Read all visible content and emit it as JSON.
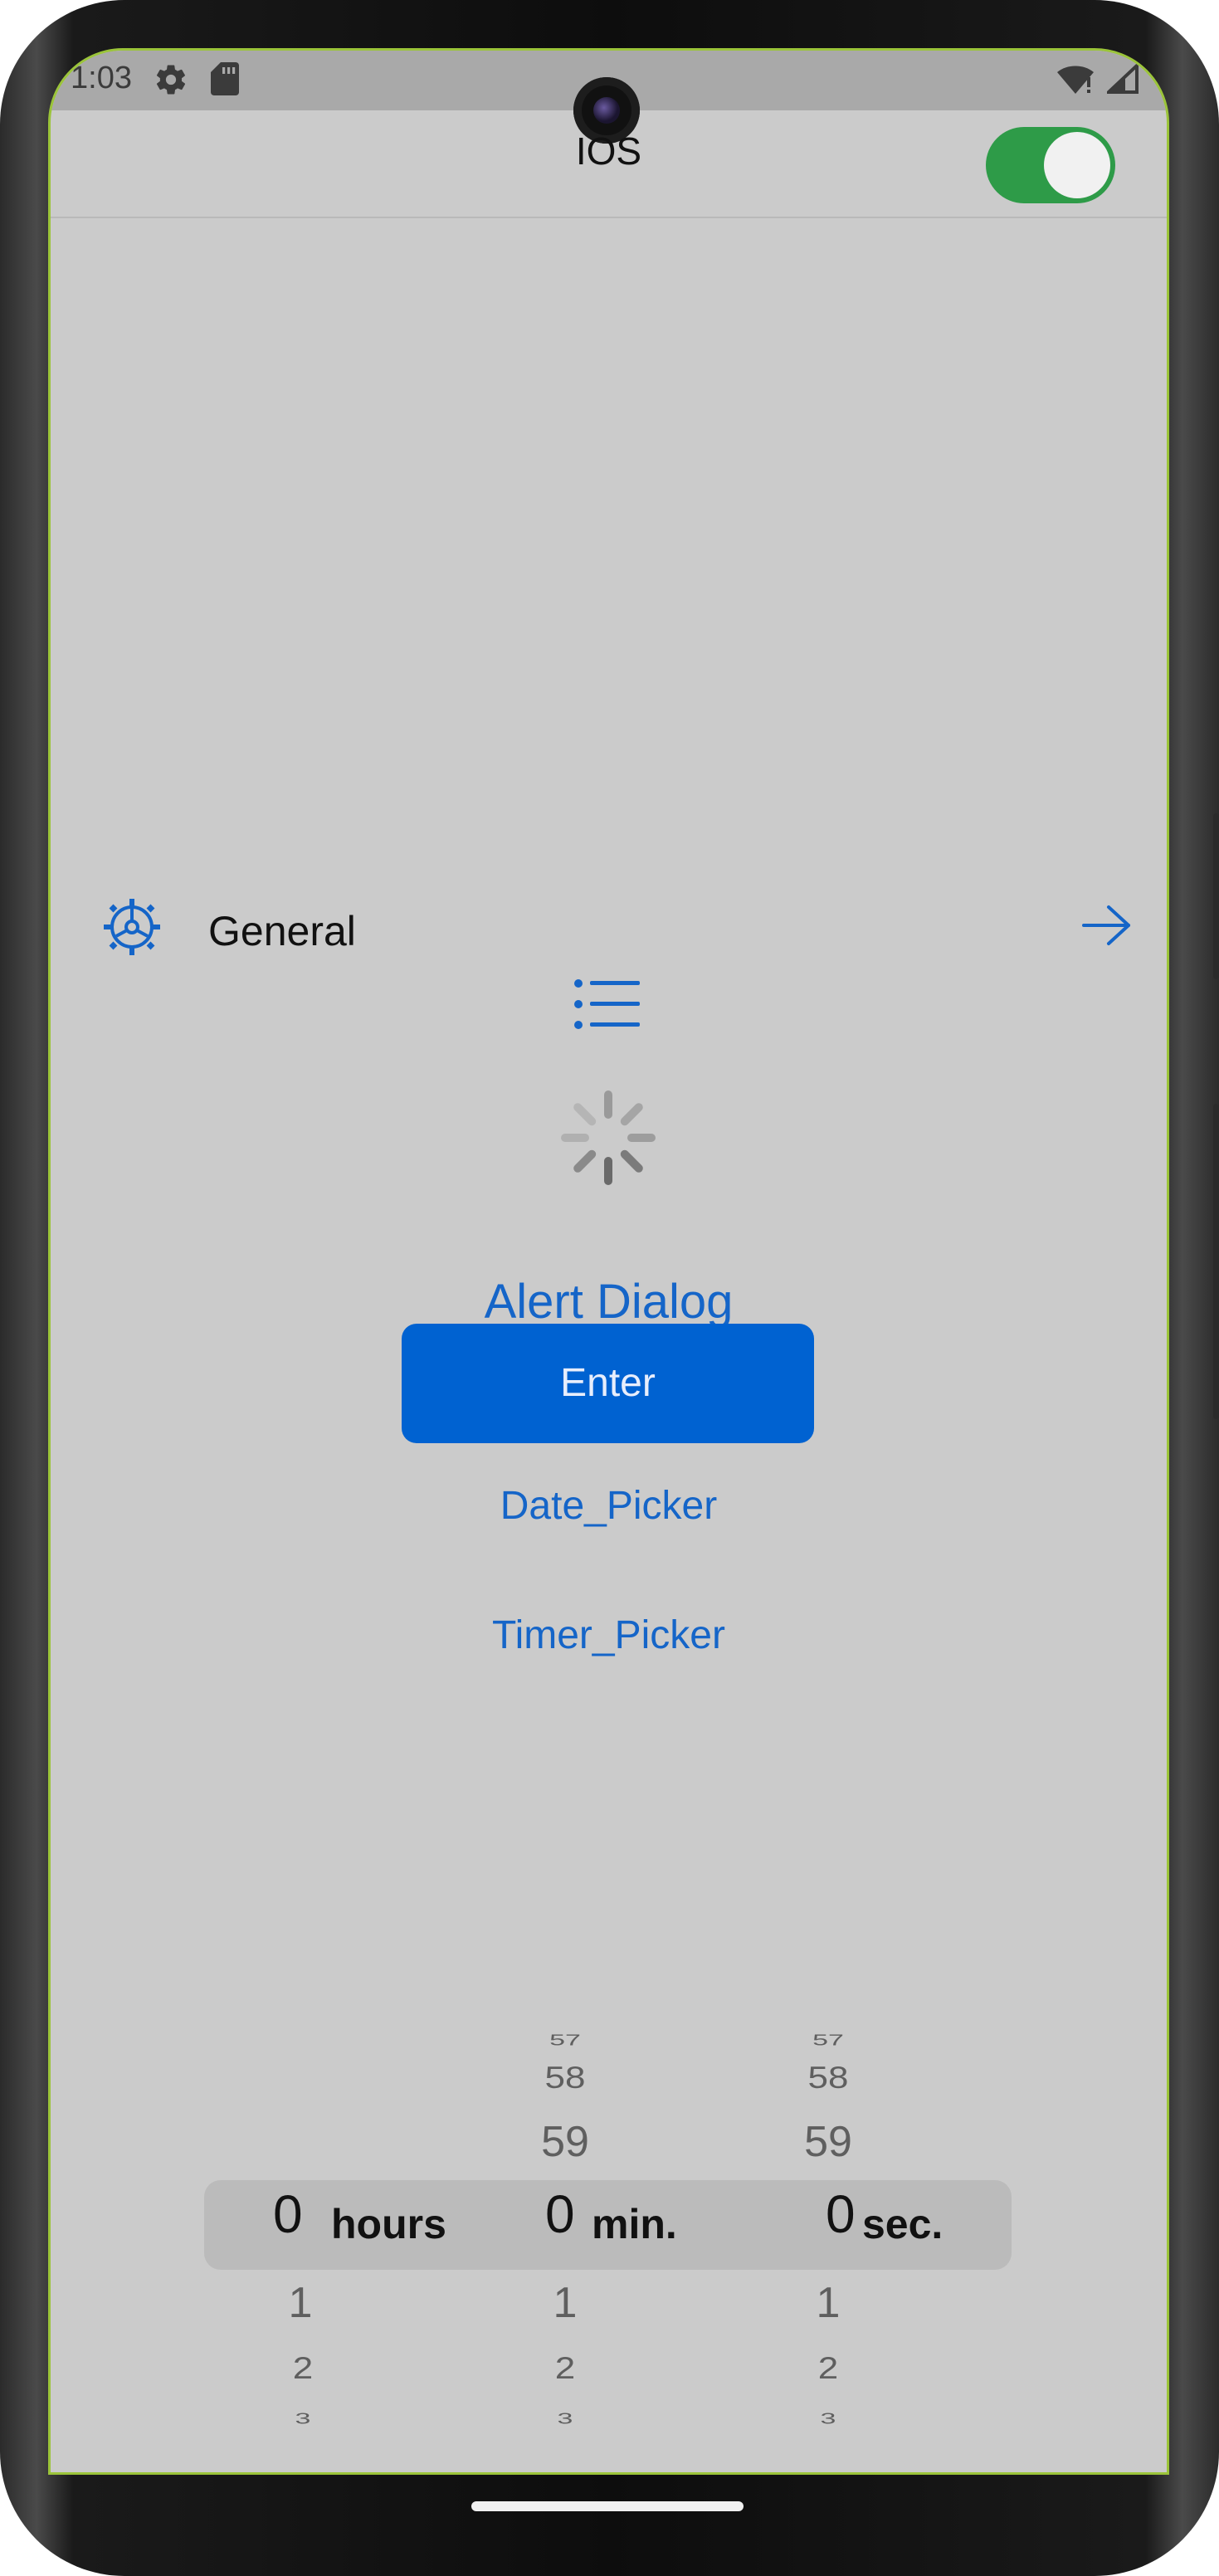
{
  "status_bar": {
    "time": "1:03",
    "icons": [
      "gear-icon",
      "sd-card-icon",
      "wifi-icon",
      "signal-icon"
    ]
  },
  "app_bar": {
    "title": "IOS",
    "toggle_on": true,
    "toggle_color": "#2e9b48"
  },
  "general": {
    "label": "General",
    "icon": "gear-icon",
    "trailing_icon": "arrow-right-icon"
  },
  "list_icon": "list-icon",
  "spinner_icon": "activity-spinner-icon",
  "alert_dialog": {
    "title": "Alert Dialog"
  },
  "enter_button": {
    "label": "Enter"
  },
  "links": {
    "date_picker": "Date_Picker",
    "timer_picker": "Timer_Picker"
  },
  "timer_picker": {
    "hours": {
      "above": [
        "",
        "",
        ""
      ],
      "selected": "0",
      "unit": "hours",
      "below": [
        "1",
        "2",
        "3"
      ]
    },
    "minutes": {
      "above": [
        "57",
        "58",
        "59"
      ],
      "selected": "0",
      "unit": "min.",
      "below": [
        "1",
        "2",
        "3"
      ]
    },
    "seconds": {
      "above": [
        "57",
        "58",
        "59"
      ],
      "selected": "0",
      "unit": "sec.",
      "below": [
        "1",
        "2",
        "3"
      ]
    }
  },
  "colors": {
    "accent": "#1565c8",
    "button": "#0062d1",
    "background": "#cbcbcb"
  }
}
